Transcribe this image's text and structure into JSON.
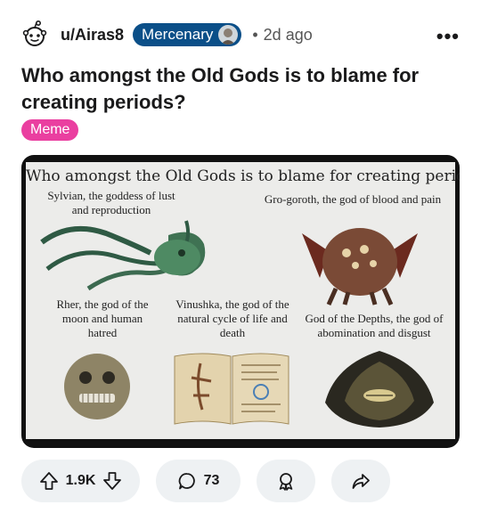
{
  "post": {
    "username": "u/Airas8",
    "flair": "Mercenary",
    "separator": "•",
    "time": "2d ago",
    "more": "•••",
    "title": "Who amongst the Old Gods is to blame for creating periods?",
    "tag": "Meme",
    "tag_color": "#ea3fa0",
    "flair_color": "#0b4f88"
  },
  "meme": {
    "title": "Who amongst the Old Gods is to blame for creating periods?",
    "sylvian": "Sylvian, the goddess of lust and reproduction",
    "grogoroth": "Gro-goroth, the god of blood and pain",
    "rher": "Rher, the god of the moon and human hatred",
    "vinushka": "Vinushka, the god of the natural cycle of life and death",
    "depths": "God of the Depths, the god of abomination and disgust"
  },
  "actions": {
    "upvotes": "1.9K",
    "comments": "73"
  }
}
